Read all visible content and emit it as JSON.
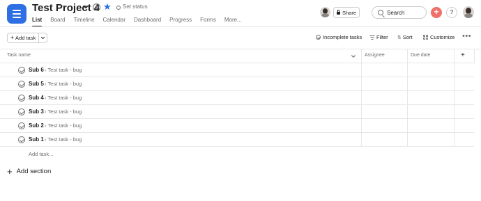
{
  "project": {
    "title": "Test Project 4",
    "set_status": "Set status",
    "info_glyph": "i"
  },
  "tabs": [
    {
      "label": "List",
      "active": true
    },
    {
      "label": "Board",
      "active": false
    },
    {
      "label": "Timeline",
      "active": false
    },
    {
      "label": "Calendar",
      "active": false
    },
    {
      "label": "Dashboard",
      "active": false
    },
    {
      "label": "Progress",
      "active": false
    },
    {
      "label": "Forms",
      "active": false
    },
    {
      "label": "More...",
      "active": false
    }
  ],
  "header_actions": {
    "share_label": "Share",
    "search_placeholder": "Search",
    "add_glyph": "+",
    "help_glyph": "?"
  },
  "toolbar": {
    "add_task_label": "Add task",
    "incomplete_label": "Incomplete tasks",
    "filter_label": "Filter",
    "sort_label": "Sort",
    "customize_label": "Customize",
    "more_glyph": "•••"
  },
  "table": {
    "columns": {
      "task_name": "Task name",
      "assignee": "Assignee",
      "due_date": "Due date",
      "add_column": "+"
    },
    "rows": [
      {
        "name": "Sub 6",
        "parent": "‹ Test task - bug"
      },
      {
        "name": "Sub 5",
        "parent": "‹ Test task - bug"
      },
      {
        "name": "Sub 4",
        "parent": "‹ Test task - bug"
      },
      {
        "name": "Sub 3",
        "parent": "‹ Test task - bug"
      },
      {
        "name": "Sub 2",
        "parent": "‹ Test task - bug"
      },
      {
        "name": "Sub 1",
        "parent": "‹ Test task - bug"
      }
    ],
    "add_task_link": "Add task...",
    "add_section": "Add section"
  },
  "colors": {
    "accent_blue": "#2f6fe4",
    "add_button": "#f0706a",
    "muted_text": "#6d6e6f",
    "border": "#e8e6e6"
  },
  "icons": [
    "menu-icon",
    "chevron-down-icon",
    "info-icon",
    "star-icon",
    "status-circle-icon",
    "lock-icon",
    "search-icon",
    "plus-icon",
    "help-icon",
    "check-circle-icon",
    "filter-icon",
    "sort-icon",
    "customize-icon",
    "more-icon"
  ]
}
